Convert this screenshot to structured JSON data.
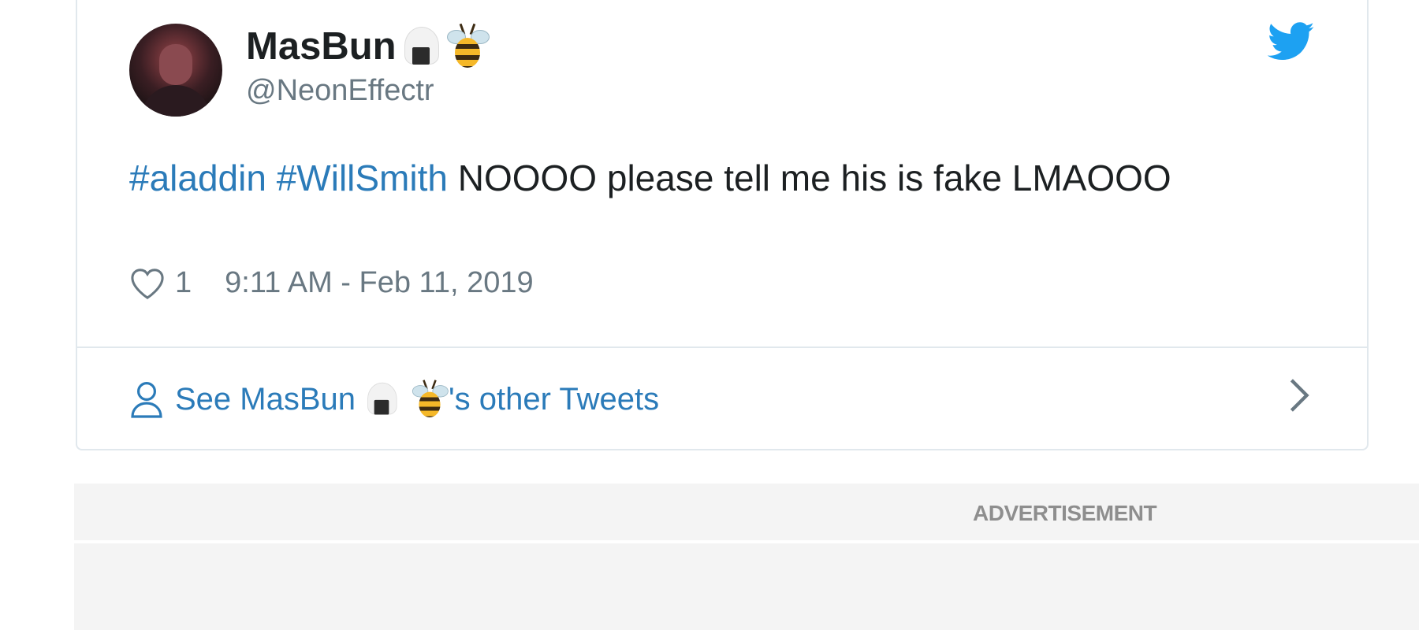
{
  "tweet": {
    "display_name": "MasBun",
    "name_emojis": [
      "onigiri-emoji",
      "bee-emoji"
    ],
    "handle": "@NeonEffectr",
    "text": {
      "hashtag_1": "#aladdin",
      "hashtag_2": "#WillSmith",
      "body": "NOOOO please tell me his is fake LMAOOO"
    },
    "likes": "1",
    "timestamp": "9:11 AM - Feb 11, 2019",
    "other_tweets_prefix": "See MasBun",
    "other_tweets_suffix": "'s other Tweets"
  },
  "icons": {
    "brand": "twitter-bird-icon",
    "like": "heart-icon",
    "profile": "person-icon",
    "more": "chevron-right-icon"
  },
  "colors": {
    "link": "#2b7bb9",
    "twitter_blue": "#1da1f2",
    "muted": "#697882",
    "border": "#e1e8ed"
  },
  "advertisement": {
    "label": "ADVERTISEMENT"
  }
}
